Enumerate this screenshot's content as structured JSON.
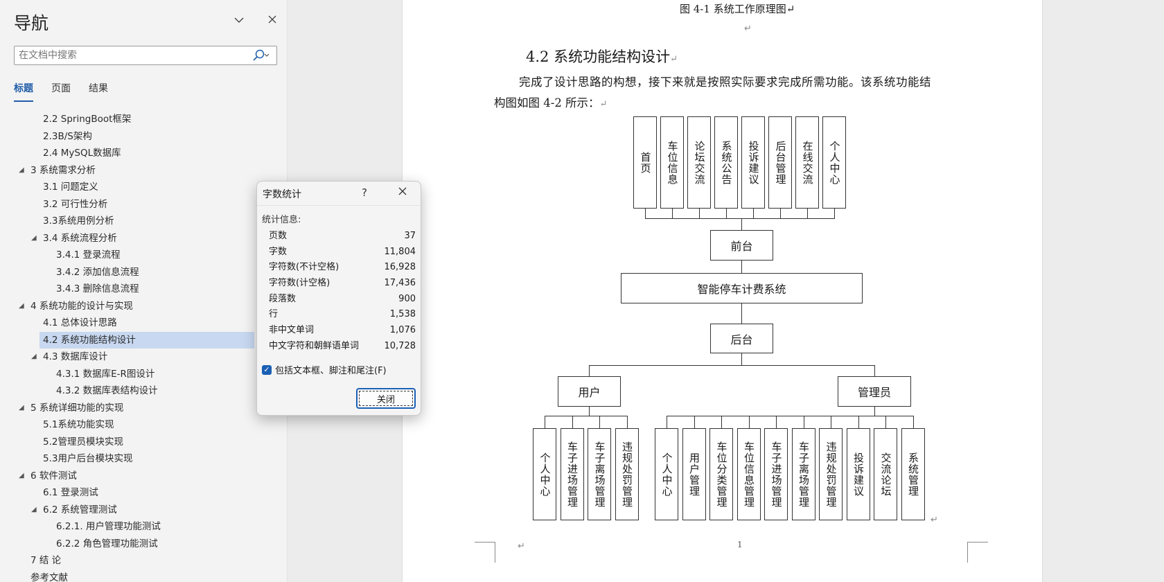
{
  "nav": {
    "title": "导航",
    "search_placeholder": "在文档中搜索",
    "tabs": [
      "标题",
      "页面",
      "结果"
    ],
    "headings": [
      {
        "label": "2.2 SpringBoot框架",
        "level": 2,
        "expanded": null,
        "selected": false
      },
      {
        "label": "2.3B/S架构",
        "level": 2,
        "expanded": null,
        "selected": false
      },
      {
        "label": "2.4 MySQL数据库",
        "level": 2,
        "expanded": null,
        "selected": false
      },
      {
        "label": "3 系统需求分析",
        "level": 1,
        "expanded": true,
        "selected": false
      },
      {
        "label": "3.1 问题定义",
        "level": 2,
        "expanded": null,
        "selected": false
      },
      {
        "label": "3.2 可行性分析",
        "level": 2,
        "expanded": null,
        "selected": false
      },
      {
        "label": "3.3系统用例分析",
        "level": 2,
        "expanded": null,
        "selected": false
      },
      {
        "label": "3.4 系统流程分析",
        "level": 2,
        "expanded": true,
        "selected": false
      },
      {
        "label": "3.4.1 登录流程",
        "level": 3,
        "expanded": null,
        "selected": false
      },
      {
        "label": "3.4.2 添加信息流程",
        "level": 3,
        "expanded": null,
        "selected": false
      },
      {
        "label": "3.4.3 删除信息流程",
        "level": 3,
        "expanded": null,
        "selected": false
      },
      {
        "label": "4 系统功能的设计与实现",
        "level": 1,
        "expanded": true,
        "selected": false
      },
      {
        "label": "4.1 总体设计思路",
        "level": 2,
        "expanded": null,
        "selected": false
      },
      {
        "label": "4.2 系统功能结构设计",
        "level": 2,
        "expanded": null,
        "selected": true
      },
      {
        "label": "4.3 数据库设计",
        "level": 2,
        "expanded": true,
        "selected": false
      },
      {
        "label": "4.3.1 数据库E-R图设计",
        "level": 3,
        "expanded": null,
        "selected": false
      },
      {
        "label": "4.3.2 数据库表结构设计",
        "level": 3,
        "expanded": null,
        "selected": false
      },
      {
        "label": "5 系统详细功能的实现",
        "level": 1,
        "expanded": true,
        "selected": false
      },
      {
        "label": "5.1系统功能实现",
        "level": 2,
        "expanded": null,
        "selected": false
      },
      {
        "label": "5.2管理员模块实现",
        "level": 2,
        "expanded": null,
        "selected": false
      },
      {
        "label": "5.3用户后台模块实现",
        "level": 2,
        "expanded": null,
        "selected": false
      },
      {
        "label": "6 软件测试",
        "level": 1,
        "expanded": true,
        "selected": false
      },
      {
        "label": "6.1 登录测试",
        "level": 2,
        "expanded": null,
        "selected": false
      },
      {
        "label": "6.2 系统管理测试",
        "level": 2,
        "expanded": true,
        "selected": false
      },
      {
        "label": "6.2.1. 用户管理功能测试",
        "level": 3,
        "expanded": null,
        "selected": false
      },
      {
        "label": "6.2.2 角色管理功能测试",
        "level": 3,
        "expanded": null,
        "selected": false
      },
      {
        "label": "7 结  论",
        "level": 1,
        "expanded": null,
        "selected": false
      },
      {
        "label": "参考文献",
        "level": 1,
        "expanded": null,
        "selected": false
      }
    ]
  },
  "document": {
    "figure_caption": "图 4-1  系统工作原理图↵",
    "paragraph_mark": "↵",
    "section_title": "4.2  系统功能结构设计",
    "body_line1": "完成了设计思路的构想，接下来就是按照实际要求完成所需功能。该系统功能结",
    "body_line2": "构图如图 4-2 所示：",
    "page_number": "1",
    "diagram": {
      "front_modules": [
        "首页",
        "车位信息",
        "论坛交流",
        "系统公告",
        "投诉建议",
        "后台管理",
        "在线交流",
        "个人中心"
      ],
      "front_label": "前台",
      "system_label": "智能停车计费系统",
      "back_label": "后台",
      "user_label": "用户",
      "admin_label": "管理员",
      "user_modules": [
        "个人中心",
        "车子进场管理",
        "车子离场管理",
        "违规处罚管理"
      ],
      "admin_modules": [
        "个人中心",
        "用户管理",
        "车位分类管理",
        "车位信息管理",
        "车子进场管理",
        "车子离场管理",
        "违规处罚管理",
        "投诉建议",
        "交流论坛",
        "系统管理"
      ]
    }
  },
  "dialog": {
    "title": "字数统计",
    "help": "?",
    "stats_label": "统计信息:",
    "stats": [
      {
        "label": "页数",
        "value": "37"
      },
      {
        "label": "字数",
        "value": "11,804"
      },
      {
        "label": "字符数(不计空格)",
        "value": "16,928"
      },
      {
        "label": "字符数(计空格)",
        "value": "17,436"
      },
      {
        "label": "段落数",
        "value": "900"
      },
      {
        "label": "行",
        "value": "1,538"
      },
      {
        "label": "非中文单词",
        "value": "1,076"
      },
      {
        "label": "中文字符和朝鲜语单词",
        "value": "10,728"
      }
    ],
    "include_checkbox_label": "包括文本框、脚注和尾注(F)",
    "include_checked": true,
    "close_button": "关闭"
  }
}
